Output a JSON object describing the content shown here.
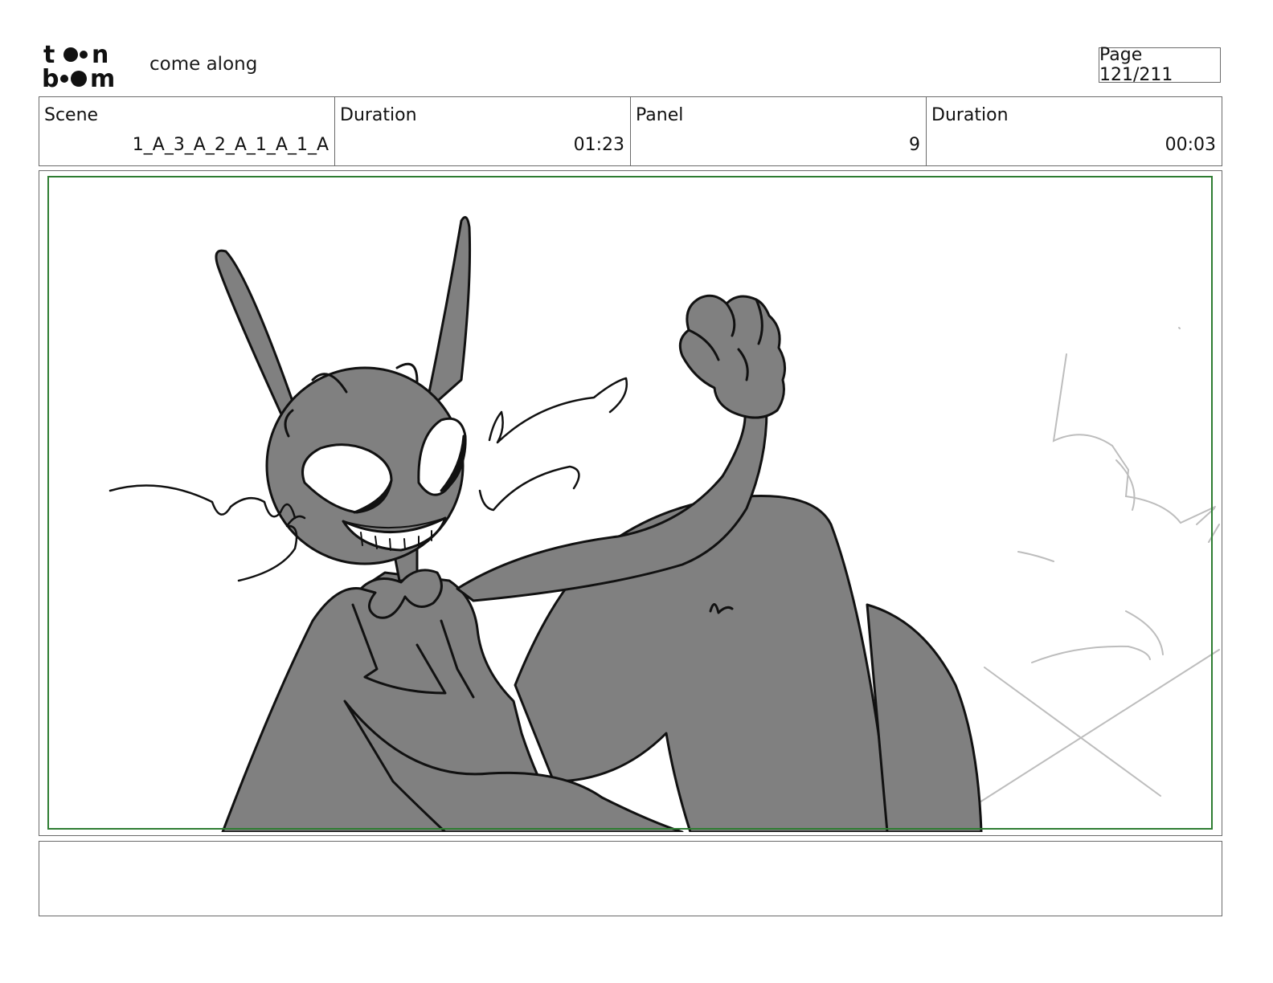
{
  "header": {
    "logo_text": "toon boom",
    "project_title": "come along",
    "page_indicator": "Page 121/211"
  },
  "info": {
    "scene_label": "Scene",
    "scene_value": "1_A_3_A_2_A_1_A_1_A",
    "scene_duration_label": "Duration",
    "scene_duration_value": "01:23",
    "panel_label": "Panel",
    "panel_value": "9",
    "panel_duration_label": "Duration",
    "panel_duration_value": "00:03"
  },
  "notes": {
    "text": ""
  },
  "colors": {
    "safe_area_frame": "#2e7d32",
    "character_fill": "#808080",
    "line": "#111111",
    "rough_sketch": "#bdbdbd"
  }
}
